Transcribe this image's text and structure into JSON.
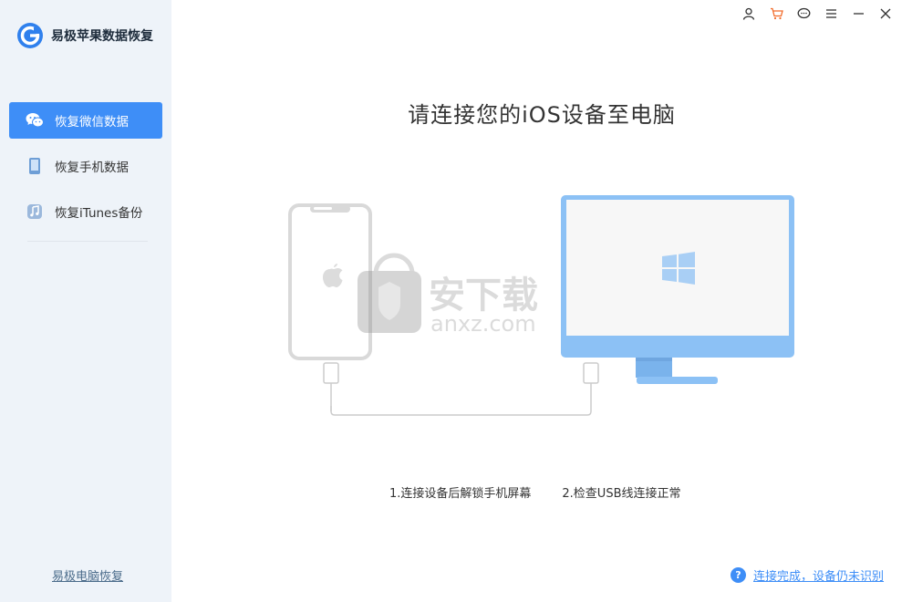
{
  "app": {
    "title": "易极苹果数据恢复"
  },
  "sidebar": {
    "items": [
      {
        "label": "恢复微信数据",
        "icon": "wechat-icon",
        "active": true
      },
      {
        "label": "恢复手机数据",
        "icon": "phone-icon",
        "active": false
      },
      {
        "label": "恢复iTunes备份",
        "icon": "itunes-icon",
        "active": false
      }
    ],
    "bottom_link": "易极电脑恢复"
  },
  "topbar": {
    "icons": [
      "user-icon",
      "cart-icon",
      "chat-icon",
      "menu-icon",
      "minimize-icon",
      "close-icon"
    ]
  },
  "main": {
    "headline": "请连接您的iOS设备至电脑",
    "steps": [
      "1.连接设备后解锁手机屏幕",
      "2.检查USB线连接正常"
    ],
    "help_text": "连接完成，设备仍未识别",
    "help_icon_glyph": "?"
  },
  "colors": {
    "accent": "#3e8ef7",
    "sidebar_bg": "#eef3f9",
    "monitor": "#8cc1f5",
    "phone_outline": "#d9d9d9"
  }
}
